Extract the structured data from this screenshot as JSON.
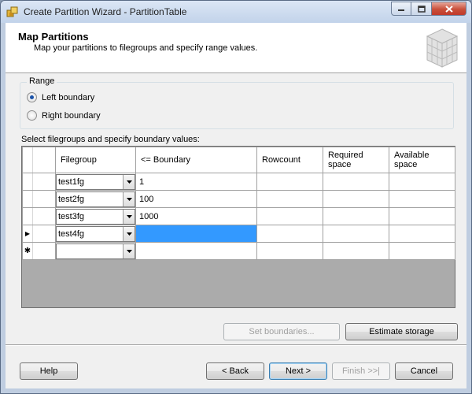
{
  "window": {
    "title": "Create Partition Wizard - PartitionTable"
  },
  "header": {
    "title": "Map Partitions",
    "subtitle": "Map your partitions to filegroups and specify range values."
  },
  "range": {
    "legend": "Range",
    "options": [
      {
        "label": "Left boundary",
        "checked": true
      },
      {
        "label": "Right boundary",
        "checked": false
      }
    ]
  },
  "grid": {
    "label": "Select filegroups and specify boundary values:",
    "columns": {
      "filegroup": "Filegroup",
      "boundary": "<= Boundary",
      "rowcount": "Rowcount",
      "required_line1": "Required",
      "required_line2": "space",
      "available_line1": "Available",
      "available_line2": "space"
    },
    "rows": [
      {
        "filegroup": "test1fg",
        "boundary": "1"
      },
      {
        "filegroup": "test2fg",
        "boundary": "100"
      },
      {
        "filegroup": "test3fg",
        "boundary": "1000"
      },
      {
        "filegroup": "test4fg",
        "boundary": ""
      },
      {
        "filegroup": "",
        "boundary": ""
      }
    ],
    "current_row_marker": "▶",
    "new_row_marker": "✱"
  },
  "actions": {
    "set_boundaries": "Set boundaries...",
    "estimate_storage": "Estimate storage"
  },
  "footer": {
    "help": "Help",
    "back": "< Back",
    "next": "Next >",
    "finish": "Finish >>|",
    "cancel": "Cancel"
  },
  "colors": {
    "selection": "#3399ff",
    "radio_dot": "#1a52a8",
    "close_button": "#c94f3a"
  }
}
